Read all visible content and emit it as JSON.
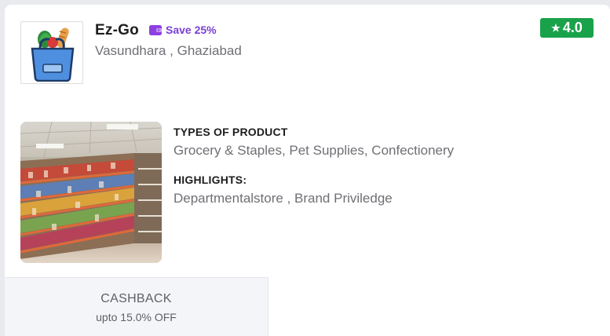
{
  "store": {
    "name": "Ez-Go",
    "offer": "Save 25%",
    "location": "Vasundhara , Ghaziabad",
    "rating": "4.0",
    "logo_icon": "grocery-bag-icon",
    "photo": "store-interior-photo"
  },
  "product_types": {
    "heading": "TYPES OF PRODUCT",
    "text": "Grocery & Staples, Pet Supplies, Confectionery"
  },
  "highlights": {
    "heading": "HIGHLIGHTS:",
    "text": "Departmentalstore , Brand Priviledge"
  },
  "cashback": {
    "title": "CASHBACK",
    "subtitle": "upto 15.0% OFF"
  },
  "colors": {
    "rating_bg": "#1aa24a",
    "offer_purple": "#7a3fd6"
  }
}
